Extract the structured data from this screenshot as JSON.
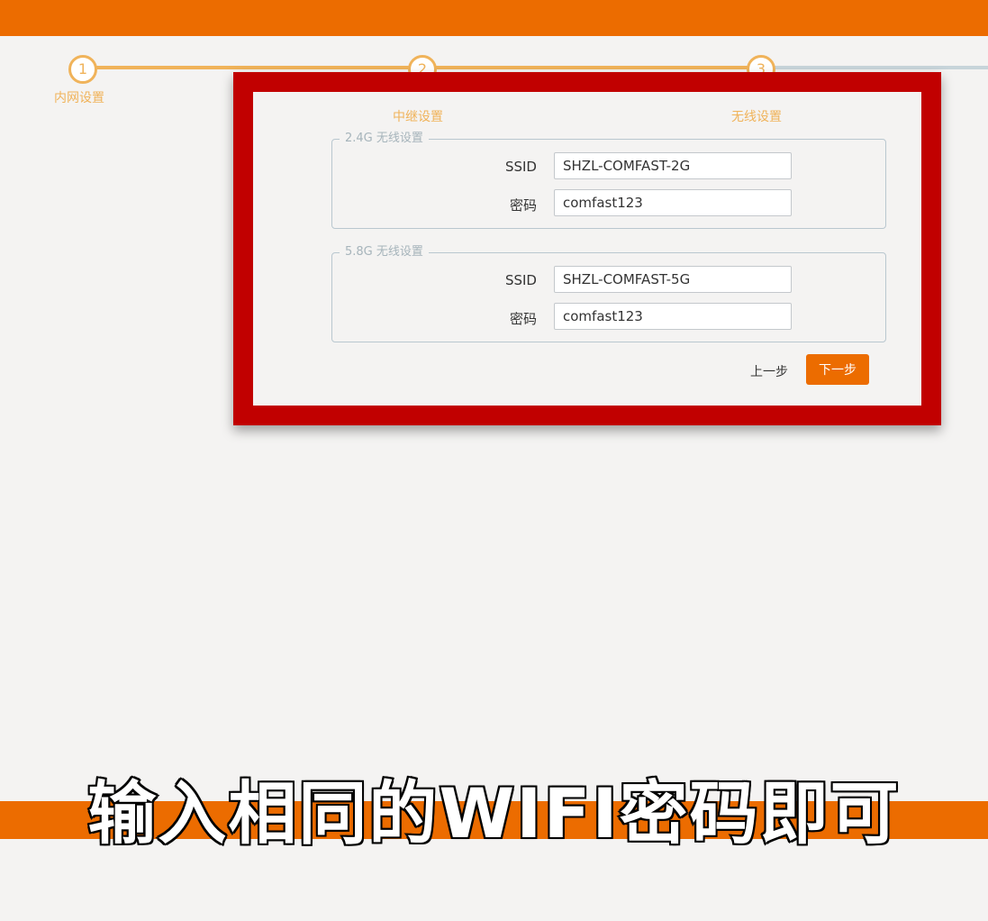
{
  "wizard": {
    "steps": [
      {
        "number": "1",
        "label": "内网设置"
      },
      {
        "number": "2",
        "label": "中继设置"
      },
      {
        "number": "3",
        "label": "无线设置"
      }
    ]
  },
  "wifi_24": {
    "legend": "2.4G 无线设置",
    "ssid_label": "SSID",
    "ssid_value": "SHZL-COMFAST-2G",
    "password_label": "密码",
    "password_value": "comfast123"
  },
  "wifi_58": {
    "legend": "5.8G 无线设置",
    "ssid_label": "SSID",
    "ssid_value": "SHZL-COMFAST-5G",
    "password_label": "密码",
    "password_value": "comfast123"
  },
  "buttons": {
    "prev_label": "上一步",
    "next_label": "下一步"
  },
  "caption": "输入相同的WIFI密码即可",
  "colors": {
    "accent": "#ec6c00",
    "step_done": "#f0b35a",
    "highlight_frame": "#c10000"
  }
}
